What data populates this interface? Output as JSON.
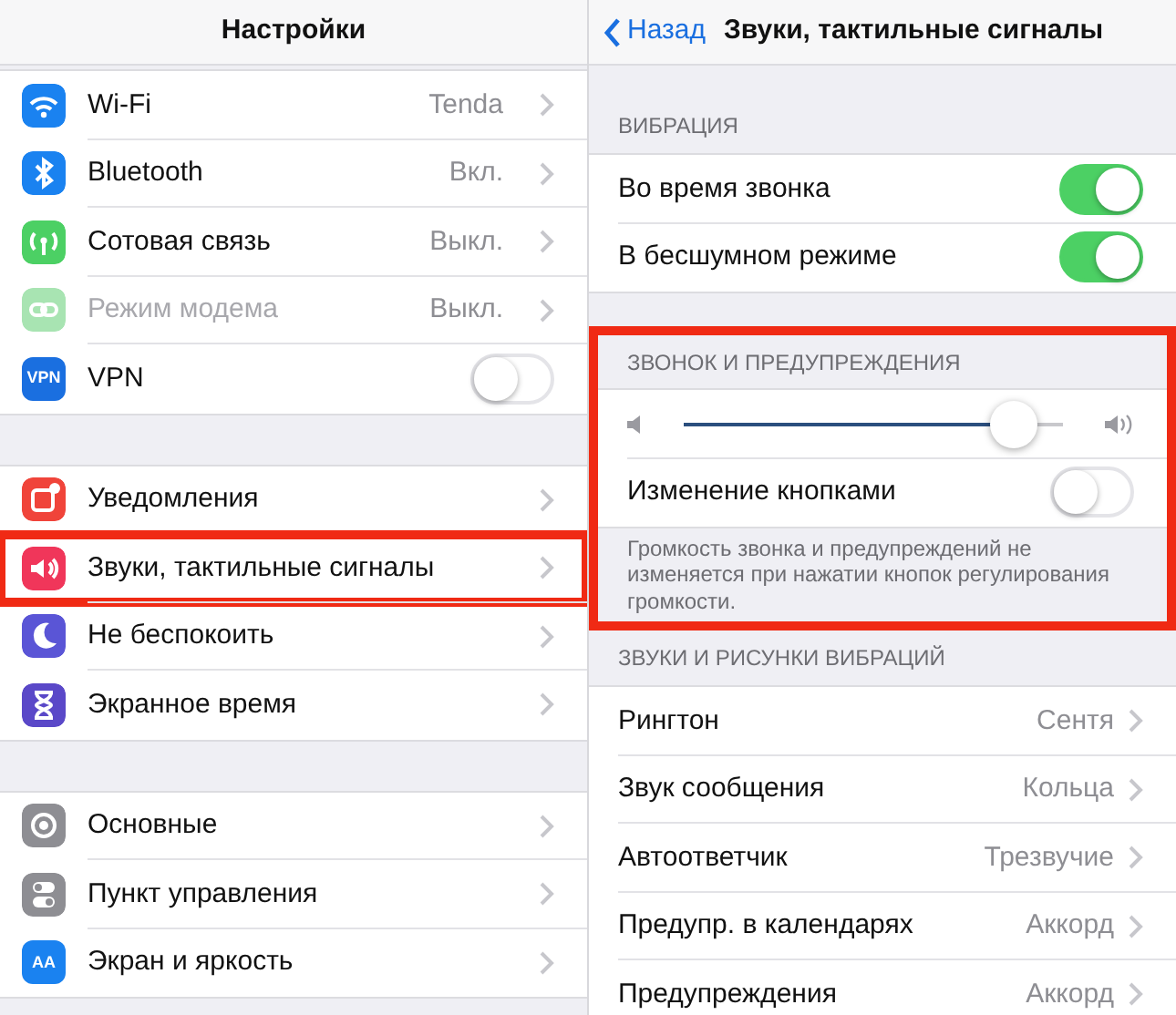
{
  "settings": {
    "title": "Настройки",
    "groups": [
      {
        "items": [
          {
            "label": "Wi-Fi",
            "value": "Tenda",
            "kind": "link",
            "color": "#1a82f0",
            "disabled": false,
            "highlighted": false
          },
          {
            "label": "Bluetooth",
            "value": "Вкл.",
            "kind": "link",
            "color": "#1a82f0",
            "disabled": false,
            "highlighted": false
          },
          {
            "label": "Сотовая связь",
            "value": "Выкл.",
            "kind": "link",
            "color": "#4cd064",
            "disabled": false,
            "highlighted": false
          },
          {
            "label": "Режим модема",
            "value": "Выкл.",
            "kind": "link",
            "color": "#a8e4b2",
            "disabled": true,
            "highlighted": false
          },
          {
            "label": "VPN",
            "icon_text": "VPN",
            "kind": "toggle",
            "on": false,
            "color": "#1a6fe0",
            "disabled": false,
            "highlighted": false
          }
        ]
      },
      {
        "items": [
          {
            "label": "Уведомления",
            "kind": "link",
            "color": "#f0443a",
            "disabled": false,
            "highlighted": false
          },
          {
            "label": "Звуки, тактильные сигналы",
            "kind": "link",
            "color": "#f0365a",
            "disabled": false,
            "highlighted": true
          },
          {
            "label": "Не беспокоить",
            "kind": "link",
            "color": "#5a55d6",
            "disabled": false,
            "highlighted": false
          },
          {
            "label": "Экранное время",
            "kind": "link",
            "color": "#5a48c8",
            "disabled": false,
            "highlighted": false
          }
        ]
      },
      {
        "items": [
          {
            "label": "Основные",
            "kind": "link",
            "color": "#8e8e93",
            "disabled": false,
            "highlighted": false
          },
          {
            "label": "Пункт управления",
            "kind": "link",
            "color": "#8e8e93",
            "disabled": false,
            "highlighted": false
          },
          {
            "label": "Экран и яркость",
            "icon_text": "AA",
            "kind": "link",
            "color": "#1a82f0",
            "disabled": false,
            "highlighted": false
          }
        ]
      }
    ]
  },
  "sounds": {
    "back": "Назад",
    "title": "Звуки, тактильные сигналы",
    "sections": [
      {
        "header": "ВИБРАЦИЯ",
        "highlighted": false,
        "rows": [
          {
            "kind": "toggle",
            "label": "Во время звонка",
            "on": true
          },
          {
            "kind": "toggle",
            "label": "В бесшумном режиме",
            "on": true
          }
        ]
      },
      {
        "header": "ЗВОНОК И ПРЕДУПРЕЖДЕНИЯ",
        "highlighted": true,
        "rows": [
          {
            "kind": "slider",
            "level": 0.87
          },
          {
            "kind": "toggle",
            "label": "Изменение кнопками",
            "on": false
          }
        ],
        "footer": "Громкость звонка и предупреждений не изменяется при нажатии кнопок регулирования громкости."
      },
      {
        "header": "ЗВУКИ И РИСУНКИ ВИБРАЦИЙ",
        "highlighted": false,
        "rows": [
          {
            "kind": "link",
            "label": "Рингтон",
            "value": "Сентя"
          },
          {
            "kind": "link",
            "label": "Звук сообщения",
            "value": "Кольца"
          },
          {
            "kind": "link",
            "label": "Автоответчик",
            "value": "Трезвучие"
          },
          {
            "kind": "link",
            "label": "Предупр. в календарях",
            "value": "Аккорд"
          },
          {
            "kind": "link",
            "label": "Предупреждения",
            "value": "Аккорд"
          }
        ]
      }
    ]
  }
}
